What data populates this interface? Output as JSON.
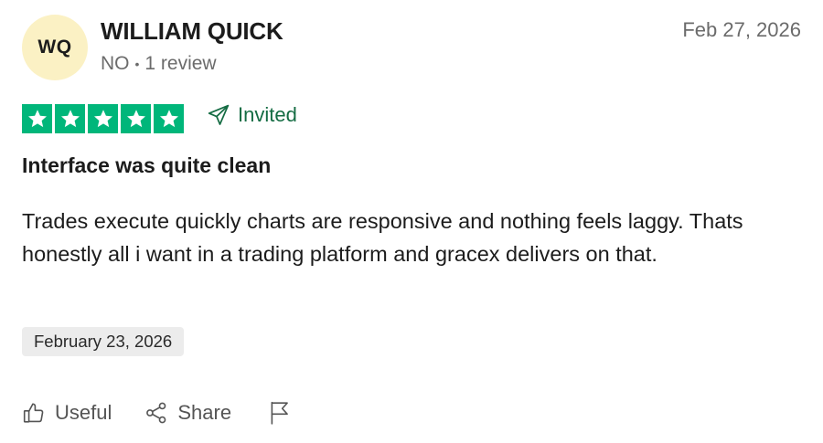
{
  "reviewer": {
    "initials": "WQ",
    "name": "WILLIAM QUICK",
    "country": "NO",
    "review_count": "1 review"
  },
  "review": {
    "posted_date": "Feb 27, 2026",
    "rating": 5,
    "rating_max": 5,
    "invited_label": "Invited",
    "title": "Interface was quite clean",
    "body": "Trades execute quickly charts are responsive and nothing feels laggy. Thats honestly all i want in a trading platform and gracex delivers on that.",
    "experience_date": "February 23, 2026"
  },
  "actions": {
    "useful_label": "Useful",
    "share_label": "Share"
  },
  "colors": {
    "star_green": "#00b67a",
    "invited_green": "#146c43",
    "avatar_bg": "#fbf1c4",
    "date_badge_bg": "#ececec"
  },
  "icons": {
    "star": "star-icon",
    "invited": "paper-plane-icon",
    "useful": "thumbs-up-icon",
    "share": "share-icon",
    "report": "flag-icon"
  }
}
